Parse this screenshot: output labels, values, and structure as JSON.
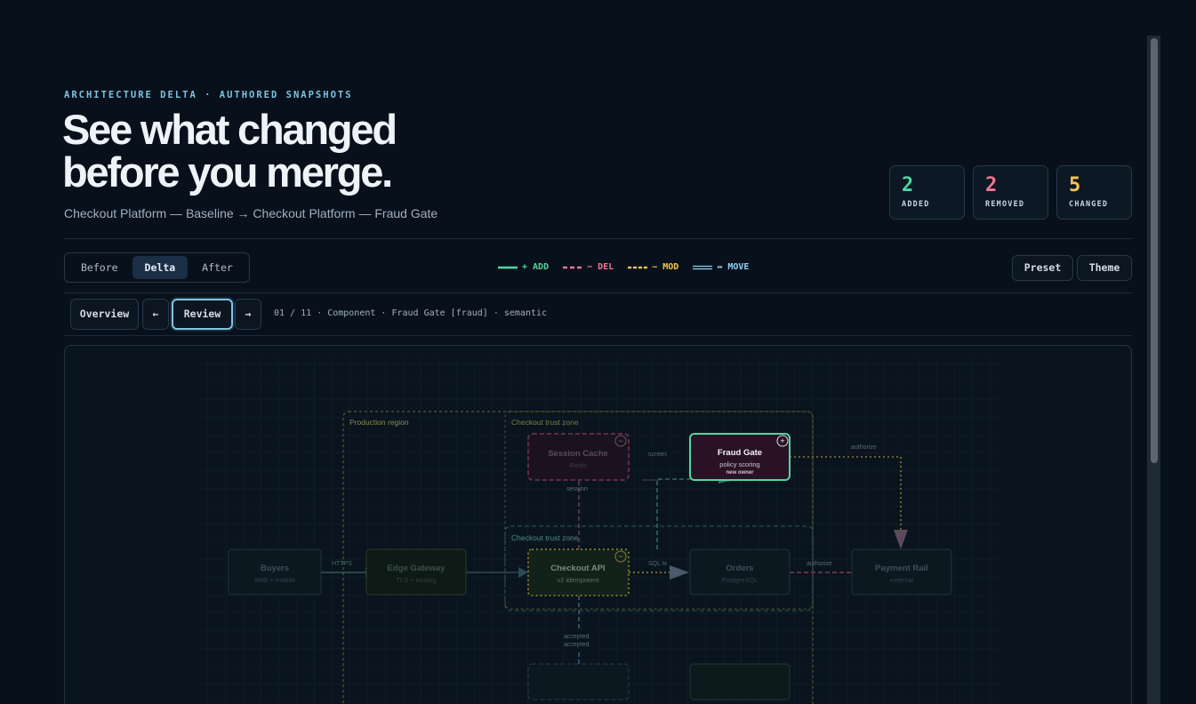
{
  "header": {
    "eyebrow": "ARCHITECTURE DELTA · AUTHORED SNAPSHOTS",
    "headline_line1": "See what changed",
    "headline_line2": "before you merge.",
    "subtitle": "Checkout Platform — Baseline → Checkout Platform — Fraud Gate"
  },
  "stats": [
    {
      "value": "2",
      "label": "ADDED",
      "color": "#4fd6a0"
    },
    {
      "value": "2",
      "label": "REMOVED",
      "color": "#f0758f"
    },
    {
      "value": "5",
      "label": "CHANGED",
      "color": "#f4c64f"
    }
  ],
  "view_modes": {
    "before": "Before",
    "delta": "Delta",
    "after": "After",
    "selected": "Delta"
  },
  "legend": {
    "add": "+ ADD",
    "del": "− DEL",
    "mod": "~ MOD",
    "move": "↔ MOVE",
    "add_color": "#4fd6a0",
    "del_color": "#f0758f",
    "mod_color": "#f4c64f",
    "move_color": "#8fd0f5"
  },
  "toolbar": {
    "preset": "Preset",
    "theme": "Theme"
  },
  "review_nav": {
    "overview": "Overview",
    "prev": "←",
    "review": "Review",
    "next": "→",
    "crumb": "01 / 11 · Component · Fraud Gate [fraud] · semantic"
  },
  "diagram": {
    "zones": {
      "production": "Production region",
      "trust_top": "Checkout trust zone",
      "trust_mid": "Checkout trust zone"
    },
    "nodes": {
      "buyers": {
        "title": "Buyers",
        "sub": "Web + mobile"
      },
      "edge": {
        "title": "Edge Gateway",
        "sub": "TLS + routing"
      },
      "session": {
        "title": "Session Cache",
        "sub": "Redis"
      },
      "fraud": {
        "title": "Fraud Gate",
        "sub": "policy scoring",
        "note": "new owner"
      },
      "checkout": {
        "title": "Checkout API",
        "sub": "v2 idempotent"
      },
      "orders": {
        "title": "Orders",
        "sub": "PostgreSQL"
      },
      "payment": {
        "title": "Payment Rail",
        "sub": "external"
      }
    },
    "edges": {
      "https": "HTTPS",
      "screen": "screen",
      "session": "session",
      "authorize_top": "authorize",
      "sql": "SQL tx",
      "authorize": "authorize",
      "accepted1": "accepted",
      "accepted2": "accepted"
    },
    "badges": {
      "add": "+",
      "del": "−",
      "mod": "~"
    }
  }
}
